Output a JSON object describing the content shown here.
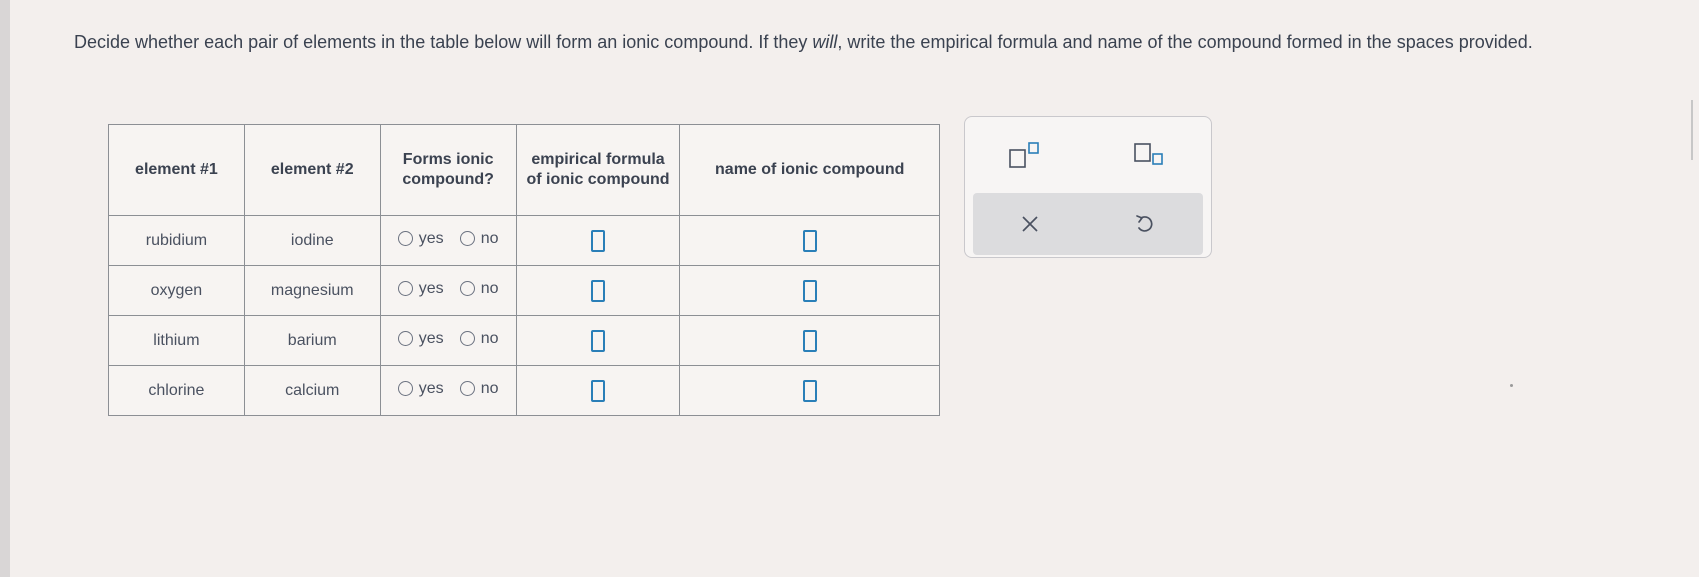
{
  "instructions": {
    "part1": "Decide whether each pair of elements in the table below will form an ionic compound. If they ",
    "emph": "will",
    "part2": ", write the empirical formula and name of the compound formed in the spaces provided."
  },
  "table": {
    "headers": {
      "element1": "element #1",
      "element2": "element #2",
      "forms_ionic": "Forms ionic compound?",
      "formula": "empirical formula of ionic compound",
      "name": "name of ionic compound"
    },
    "rows": [
      {
        "element1": "rubidium",
        "element2": "iodine",
        "yes": "yes",
        "no": "no"
      },
      {
        "element1": "oxygen",
        "element2": "magnesium",
        "yes": "yes",
        "no": "no"
      },
      {
        "element1": "lithium",
        "element2": "barium",
        "yes": "yes",
        "no": "no"
      },
      {
        "element1": "chlorine",
        "element2": "calcium",
        "yes": "yes",
        "no": "no"
      }
    ]
  },
  "toolbox": {
    "superscript_icon": "superscript-icon",
    "subscript_icon": "subscript-icon",
    "clear_icon": "close-icon",
    "undo_icon": "undo-icon",
    "clear_symbol": "×",
    "accent_color": "#2a7fb8"
  }
}
